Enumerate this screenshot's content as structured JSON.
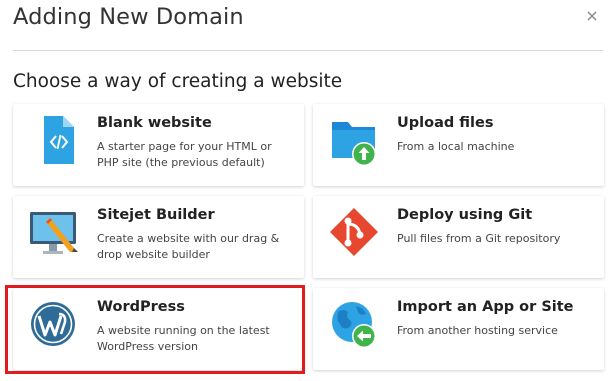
{
  "dialog": {
    "title": "Adding New Domain",
    "close_icon": "close-icon"
  },
  "subtitle": "Choose a way of creating a website",
  "options": [
    {
      "title": "Blank website",
      "description": "A starter page for your HTML or PHP site (the previous default)",
      "icon": "code-file-icon"
    },
    {
      "title": "Upload files",
      "description": "From a local machine",
      "icon": "folder-upload-icon"
    },
    {
      "title": "Sitejet Builder",
      "description": "Create a website with our drag & drop website builder",
      "icon": "monitor-pencil-icon"
    },
    {
      "title": "Deploy using Git",
      "description": "Pull files from a Git repository",
      "icon": "git-icon"
    },
    {
      "title": "WordPress",
      "description": "A website running on the latest WordPress version",
      "icon": "wordpress-icon"
    },
    {
      "title": "Import an App or Site",
      "description": "From another hosting service",
      "icon": "globe-import-icon"
    }
  ],
  "highlight_color": "#e21c1c"
}
